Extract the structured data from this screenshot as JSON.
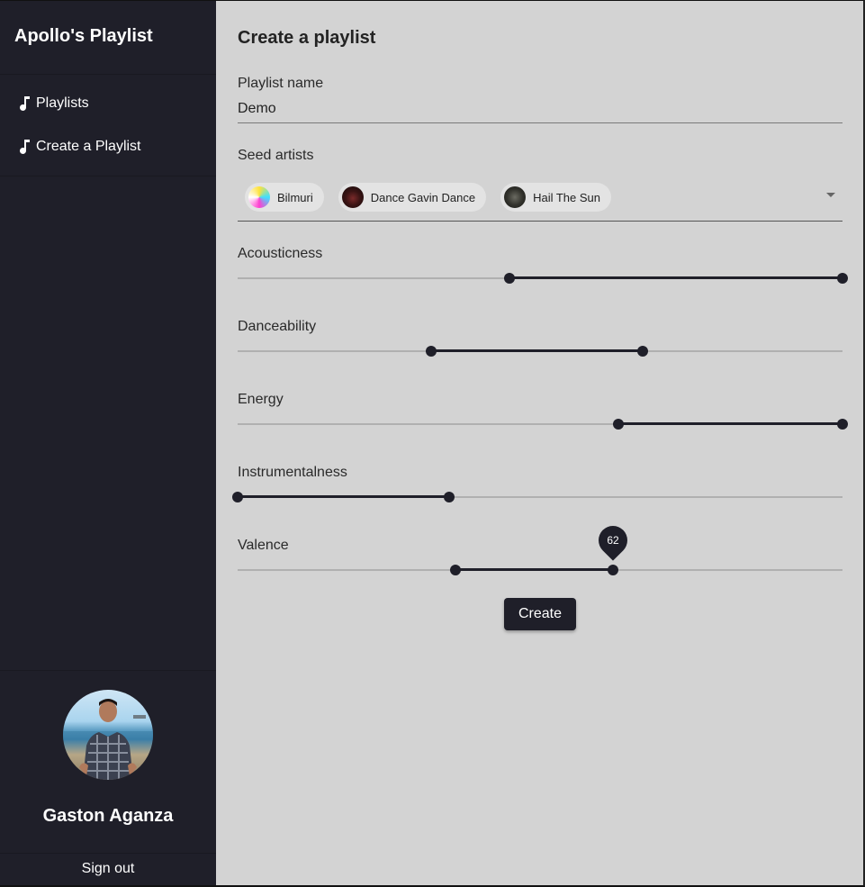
{
  "sidebar": {
    "brand": "Apollo's Playlist",
    "nav": [
      {
        "label": "Playlists",
        "icon": "music-note-icon"
      },
      {
        "label": "Create a Playlist",
        "icon": "music-note-icon"
      }
    ],
    "profile": {
      "name": "Gaston Aganza",
      "sign_out_label": "Sign out"
    }
  },
  "main": {
    "title": "Create a playlist",
    "playlist_name": {
      "label": "Playlist name",
      "value": "Demo"
    },
    "seed_artists": {
      "label": "Seed artists",
      "chips": [
        {
          "name": "Bilmuri"
        },
        {
          "name": "Dance Gavin Dance"
        },
        {
          "name": "Hail The Sun"
        }
      ]
    },
    "sliders": [
      {
        "label": "Acousticness",
        "min": 45,
        "max": 100
      },
      {
        "label": "Danceability",
        "min": 32,
        "max": 67
      },
      {
        "label": "Energy",
        "min": 63,
        "max": 100
      },
      {
        "label": "Instrumentalness",
        "min": 0,
        "max": 35
      },
      {
        "label": "Valence",
        "min": 36,
        "max": 62,
        "active_value_label": "62"
      }
    ],
    "create_label": "Create"
  },
  "colors": {
    "sidebar_bg": "#1f1f29",
    "main_bg": "#d3d3d3",
    "accent": "#1f1f29",
    "chip_bg": "#e3e3e3"
  }
}
